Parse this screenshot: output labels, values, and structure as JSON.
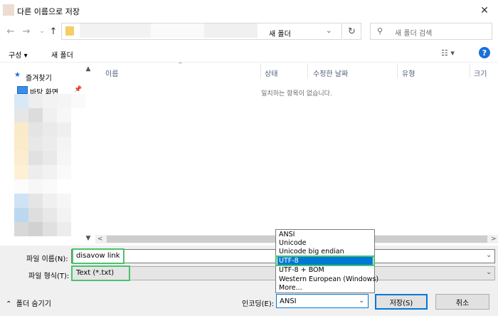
{
  "window": {
    "title": "다른 이름으로 저장"
  },
  "address": {
    "current_folder": "새 폴더"
  },
  "search": {
    "placeholder": "새 폴더 검색"
  },
  "toolbar": {
    "organize_label": "구성 ▾",
    "new_folder_label": "새 폴더"
  },
  "nav": {
    "items": [
      {
        "label": "즐겨찾기",
        "icon": "star-icon"
      },
      {
        "label": "바탕 화면",
        "icon": "desktop-icon"
      }
    ]
  },
  "file_list": {
    "columns": [
      "이름",
      "상태",
      "수정한 날짜",
      "유형",
      "크기"
    ],
    "empty_message": "일치하는 항목이 없습니다."
  },
  "form": {
    "filename_label": "파일 이름(N):",
    "filename_value": "disavow link",
    "filetype_label": "파일 형식(T):",
    "filetype_value": "Text (*.txt)",
    "hide_folders_label": "폴더 숨기기",
    "encoding_label": "인코딩(E):",
    "encoding_value": "ANSI",
    "save_label": "저장(S)",
    "cancel_label": "취소"
  },
  "encoding_options": [
    "ANSI",
    "Unicode",
    "Unicode big endian",
    "UTF-8",
    "UTF-8 + BOM",
    "Western European (Windows)",
    "More..."
  ],
  "encoding_selected": "UTF-8",
  "colors": {
    "accent": "#0078d7",
    "highlight_box": "#4cc36b",
    "folder": "#f3cf65"
  }
}
